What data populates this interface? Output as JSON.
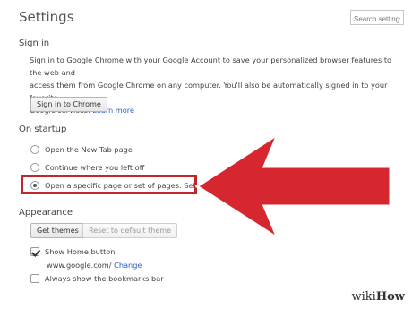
{
  "header": {
    "title": "Settings",
    "search_placeholder": "Search settings"
  },
  "sign_in": {
    "heading": "Sign in",
    "line1": "Sign in to Google Chrome with your Google Account to save your personalized browser features to the web and",
    "line2": "access them from Google Chrome on any computer. You'll also be automatically signed in to your favorite",
    "line3_text": "Google services.",
    "learn_more": "Learn more",
    "button": "Sign in to Chrome"
  },
  "on_startup": {
    "heading": "On startup",
    "options": [
      {
        "label": "Open the New Tab page",
        "selected": false
      },
      {
        "label": "Continue where you left off",
        "selected": false
      },
      {
        "label": "Open a specific page or set of pages.",
        "selected": true
      }
    ],
    "set_pages_link": "Set pages"
  },
  "appearance": {
    "heading": "Appearance",
    "get_themes": "Get themes",
    "reset_theme": "Reset to default theme",
    "show_home_button": {
      "label": "Show Home button",
      "checked": true
    },
    "home_url": "www.google.com/",
    "change_link": "Change",
    "show_bookmarks_bar": {
      "label": "Always show the bookmarks bar",
      "checked": false
    }
  },
  "annotation": {
    "arrow_color": "#d6262f",
    "highlight_color": "#c0272d"
  },
  "watermark": {
    "part1": "wiki",
    "part2": "How"
  }
}
